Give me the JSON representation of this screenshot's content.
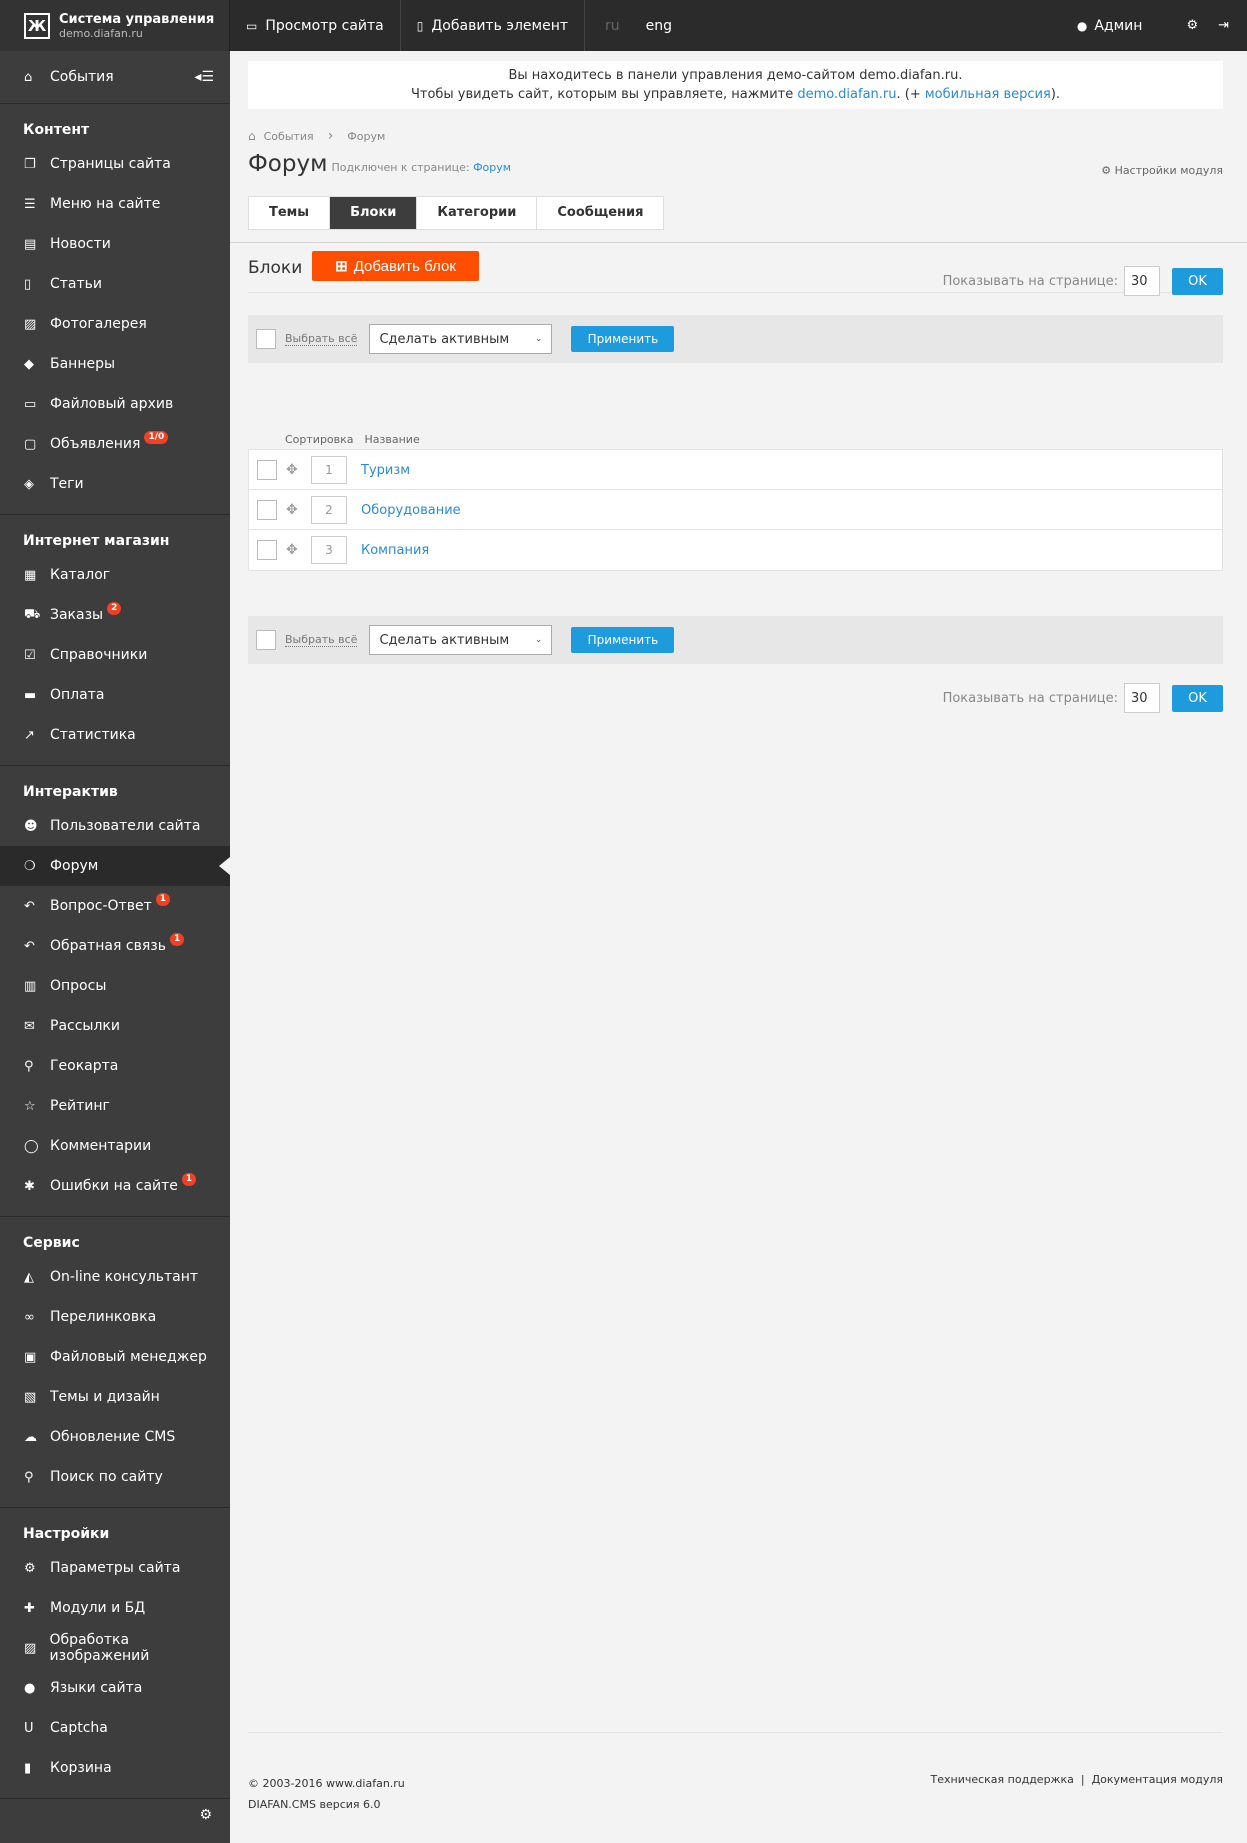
{
  "brand": {
    "title": "Система управления",
    "subtitle": "demo.diafan.ru",
    "logo": "Ж"
  },
  "topnav": {
    "view_site": "Просмотр сайта",
    "add_element": "Добавить элемент",
    "lang_ru": "ru",
    "lang_eng": "eng",
    "admin": "Админ"
  },
  "sidebar": {
    "events": "События",
    "sections": [
      {
        "title": "Контент",
        "items": [
          {
            "label": "Страницы сайта",
            "icon": "pages-icon",
            "glyph": "❐"
          },
          {
            "label": "Меню на сайте",
            "icon": "menu-list-icon",
            "glyph": "☰"
          },
          {
            "label": "Новости",
            "icon": "news-icon",
            "glyph": "▤"
          },
          {
            "label": "Статьи",
            "icon": "article-icon",
            "glyph": "▯"
          },
          {
            "label": "Фотогалерея",
            "icon": "photo-icon",
            "glyph": "▨"
          },
          {
            "label": "Баннеры",
            "icon": "tag-icon",
            "glyph": "◆"
          },
          {
            "label": "Файловый архив",
            "icon": "folder-icon",
            "glyph": "▭"
          },
          {
            "label": "Объявления",
            "icon": "ads-icon",
            "glyph": "▢",
            "badge": "1/0"
          },
          {
            "label": "Теги",
            "icon": "tags-icon",
            "glyph": "◈"
          }
        ]
      },
      {
        "title": "Интернет магазин",
        "items": [
          {
            "label": "Каталог",
            "icon": "catalog-icon",
            "glyph": "▦"
          },
          {
            "label": "Заказы",
            "icon": "cart-icon",
            "glyph": "⛟",
            "badge": "2"
          },
          {
            "label": "Справочники",
            "icon": "check-icon",
            "glyph": "☑"
          },
          {
            "label": "Оплата",
            "icon": "card-icon",
            "glyph": "▬"
          },
          {
            "label": "Статистика",
            "icon": "stats-icon",
            "glyph": "↗"
          }
        ]
      },
      {
        "title": "Интерактив",
        "items": [
          {
            "label": "Пользователи сайта",
            "icon": "users-icon",
            "glyph": "☻"
          },
          {
            "label": "Форум",
            "icon": "forum-icon",
            "glyph": "❍",
            "active": true
          },
          {
            "label": "Вопрос-Ответ",
            "icon": "reply-icon",
            "glyph": "↶",
            "badge": "1"
          },
          {
            "label": "Обратная связь",
            "icon": "feedback-icon",
            "glyph": "↶",
            "badge": "1"
          },
          {
            "label": "Опросы",
            "icon": "poll-icon",
            "glyph": "▥"
          },
          {
            "label": "Рассылки",
            "icon": "mail-icon",
            "glyph": "✉"
          },
          {
            "label": "Геокарта",
            "icon": "map-marker-icon",
            "glyph": "⚲"
          },
          {
            "label": "Рейтинг",
            "icon": "star-icon",
            "glyph": "☆"
          },
          {
            "label": "Комментарии",
            "icon": "comment-icon",
            "glyph": "◯"
          },
          {
            "label": "Ошибки на сайте",
            "icon": "bug-icon",
            "glyph": "✱",
            "badge": "1"
          }
        ]
      },
      {
        "title": "Сервис",
        "items": [
          {
            "label": "On-line консультант",
            "icon": "graduation-icon",
            "glyph": "◭"
          },
          {
            "label": "Перелинковка",
            "icon": "link-icon",
            "glyph": "∞"
          },
          {
            "label": "Файловый менеджер",
            "icon": "file-manager-icon",
            "glyph": "▣"
          },
          {
            "label": "Темы и дизайн",
            "icon": "design-icon",
            "glyph": "▧"
          },
          {
            "label": "Обновление CMS",
            "icon": "cloud-icon",
            "glyph": "☁"
          },
          {
            "label": "Поиск по сайту",
            "icon": "search-icon",
            "glyph": "⚲"
          }
        ]
      },
      {
        "title": "Настройки",
        "items": [
          {
            "label": "Параметры сайта",
            "icon": "gears-icon",
            "glyph": "⚙"
          },
          {
            "label": "Модули и БД",
            "icon": "puzzle-icon",
            "glyph": "✚"
          },
          {
            "label": "Обработка изображений",
            "icon": "image-icon",
            "glyph": "▨"
          },
          {
            "label": "Языки сайта",
            "icon": "globe-icon",
            "glyph": "●"
          },
          {
            "label": "Captcha",
            "icon": "underline-icon",
            "glyph": "U"
          },
          {
            "label": "Корзина",
            "icon": "trash-icon",
            "glyph": "▮"
          }
        ]
      }
    ]
  },
  "notice": {
    "line1": "Вы находитесь в панели управления демо-сайтом demo.diafan.ru.",
    "line2_pre": "Чтобы увидеть сайт, которым вы управляете, нажмите ",
    "line2_link": "demo.diafan.ru",
    "line2_mid": ". (+ ",
    "line2_link2": "мобильная версия",
    "line2_post": ")."
  },
  "breadcrumb": {
    "home": "События",
    "current": "Форум"
  },
  "page": {
    "title": "Форум",
    "connected_label": "Подключен к странице:",
    "connected_link": "Форум",
    "module_settings": "Настройки модуля"
  },
  "tabs": [
    "Темы",
    "Блоки",
    "Категории",
    "Сообщения"
  ],
  "active_tab": "Блоки",
  "blocks": {
    "label": "Блоки",
    "add_button": "Добавить блок",
    "per_page_label": "Показывать на странице:",
    "per_page_value": "30",
    "ok": "OK",
    "select_all": "Выбрать всё",
    "action_selected": "Сделать активным",
    "apply": "Применить",
    "col_sort": "Сортировка",
    "col_name": "Название",
    "rows": [
      {
        "sort": "1",
        "name": "Туризм"
      },
      {
        "sort": "2",
        "name": "Оборудование"
      },
      {
        "sort": "3",
        "name": "Компания"
      }
    ]
  },
  "footer": {
    "copyright": "© 2003-2016 www.diafan.ru",
    "version": "DIAFAN.CMS версия 6.0",
    "support": "Техническая поддержка",
    "docs": "Документация модуля"
  },
  "colors": {
    "accent": "#ff4e00",
    "primary": "#1e9bdc",
    "sidebar": "#3d3d3d",
    "badge": "#ef4123"
  }
}
